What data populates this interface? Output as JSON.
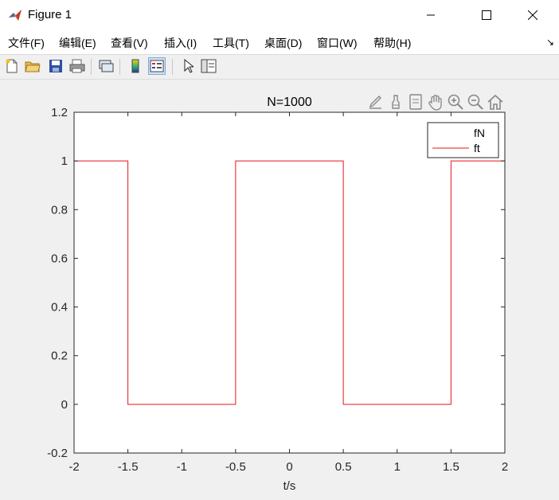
{
  "window": {
    "title": "Figure 1"
  },
  "menu": {
    "items": [
      "文件(F)",
      "编辑(E)",
      "查看(V)",
      "插入(I)",
      "工具(T)",
      "桌面(D)",
      "窗口(W)",
      "帮助(H)"
    ]
  },
  "toolbar": {
    "icons": [
      "new-figure-icon",
      "open-file-icon",
      "save-icon",
      "print-icon",
      "link-plot-icon",
      "colorbar-icon",
      "legend-icon",
      "pointer-icon",
      "property-inspector-icon"
    ]
  },
  "axes_toolbar": {
    "icons": [
      "brush-edit-icon",
      "brush-icon",
      "data-tips-icon",
      "pan-hand-icon",
      "zoom-in-icon",
      "zoom-out-icon",
      "home-icon"
    ]
  },
  "chart_data": {
    "type": "line",
    "title": "N=1000",
    "xlabel": "t/s",
    "ylabel": "",
    "xlim": [
      -2,
      2
    ],
    "ylim": [
      -0.2,
      1.2
    ],
    "xticks": [
      "-2",
      "-1.5",
      "-1",
      "-0.5",
      "0",
      "0.5",
      "1",
      "1.5",
      "2"
    ],
    "xtick_values": [
      -2,
      -1.5,
      -1,
      -0.5,
      0,
      0.5,
      1,
      1.5,
      2
    ],
    "yticks": [
      "-0.2",
      "0",
      "0.2",
      "0.4",
      "0.6",
      "0.8",
      "1",
      "1.2"
    ],
    "ytick_values": [
      -0.2,
      0,
      0.2,
      0.4,
      0.6,
      0.8,
      1,
      1.2
    ],
    "grid": false,
    "legend": {
      "position": "top-right",
      "entries": [
        "fN",
        "ft"
      ]
    },
    "series": [
      {
        "name": "fN",
        "color": "#0072bd",
        "x": [],
        "y": []
      },
      {
        "name": "ft",
        "color": "#e8141a",
        "x": [
          -2,
          -1.5,
          -1.5,
          -0.5,
          -0.5,
          0.5,
          0.5,
          1.5,
          1.5,
          2
        ],
        "y": [
          1,
          1,
          0,
          0,
          1,
          1,
          0,
          0,
          1,
          1
        ]
      }
    ]
  }
}
